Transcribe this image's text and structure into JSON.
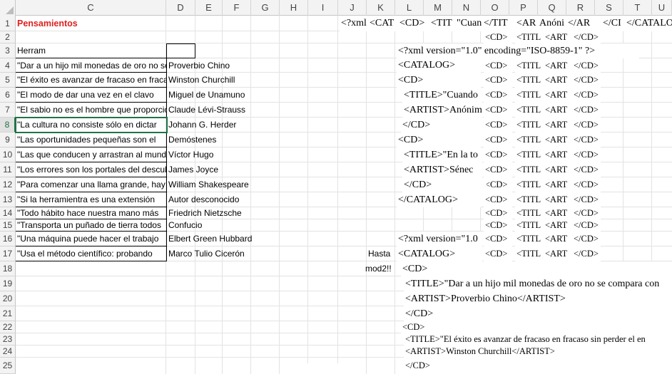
{
  "columns": [
    "C",
    "D",
    "E",
    "F",
    "G",
    "H",
    "I",
    "J",
    "K",
    "L",
    "M",
    "N",
    "O",
    "P",
    "Q",
    "R",
    "S",
    "T",
    "U"
  ],
  "rows": [
    "1",
    "2",
    "3",
    "4",
    "5",
    "6",
    "7",
    "8",
    "9",
    "10",
    "11",
    "12",
    "13",
    "14",
    "15",
    "16",
    "17",
    "18",
    "19",
    "20",
    "21",
    "22",
    "23",
    "24",
    "25"
  ],
  "active_row": "8",
  "sheet": {
    "title": "Pensamientos",
    "header_label": "Herram",
    "quotes": [
      "\"Dar a un hijo mil monedas de oro no se compara",
      "\"El éxito es avanzar de fracaso en fracaso",
      "\"El modo de dar una vez en el clavo",
      "\"El sabio no es el hombre que proporciona",
      "\"La cultura no consiste sólo en dictar",
      "\"Las oportunidades pequeñas son el",
      "\"Las que conducen y arrastran al mundo",
      "\"Los errores son los portales del descubrimiento",
      "\"Para comenzar una llama grande, hay",
      "\"Si la herramientra es una extensión",
      "\"Todo hábito hace nuestra mano más",
      "\"Transporta un puñado de tierra todos",
      "\"Una máquina puede hacer el trabajo",
      "\"Usa el método científico: probando"
    ],
    "authors": [
      "Proverbio Chino",
      "Winston Churchill",
      "Miguel de Unamuno",
      "Claude Lévi-Strauss",
      "Johann G. Herder",
      "Demóstenes",
      "Víctor Hugo",
      "James Joyce",
      "William Shakespeare",
      "Autor desconocido",
      "Friedrich Nietzsche",
      "Confucio",
      "Elbert Green Hubbard",
      "Marco Tulio Cicerón"
    ],
    "row1_xml": [
      "<?xml",
      "<CAT",
      "<CD>",
      "<TIT",
      "\"Cuan",
      "</TIT",
      "<AR",
      "Anóni",
      "</AR",
      "</CI",
      "</CATALO"
    ],
    "xml_short": [
      "<CD>",
      "<TITL",
      "<ART",
      "</CD>"
    ],
    "block": [
      "<?xml version=\"1.0\" encoding=\"ISO-8859-1\" ?>",
      "<CATALOG>",
      "<CD>",
      "<TITLE>\"Cuando",
      "<ARTIST>Anónimo",
      "</CD>",
      "<CD>",
      "<TITLE>\"En la to",
      "<ARTIST>Sénec",
      "</CD>",
      "</CATALOG>"
    ],
    "row16_xml": "<?xml version=\"1.0",
    "row17_label": "Hasta",
    "row17_xml": "<CATALOG>",
    "row18_label": "mod2!!",
    "lower_block": [
      "<CD>",
      "<TITLE>\"Dar a un hijo mil monedas de oro no se compara con",
      "<ARTIST>Proverbio Chino</ARTIST>",
      "</CD>",
      "<CD>",
      "<TITLE>\"El éxito es avanzar de fracaso en fracaso sin perder el en",
      "<ARTIST>Winston Churchill</ARTIST>",
      "</CD>"
    ]
  }
}
